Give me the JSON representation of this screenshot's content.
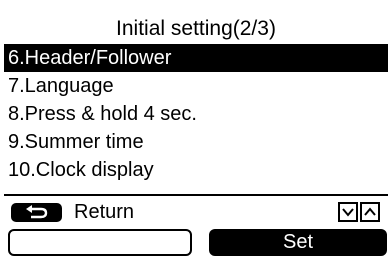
{
  "header": {
    "title": "Initial setting(2/3)"
  },
  "menu": {
    "items": [
      {
        "label": "6.Header/Follower",
        "selected": true
      },
      {
        "label": "7.Language",
        "selected": false
      },
      {
        "label": "8.Press & hold 4 sec.",
        "selected": false
      },
      {
        "label": "9.Summer time",
        "selected": false
      },
      {
        "label": "10.Clock display",
        "selected": false
      }
    ]
  },
  "footer": {
    "return_icon": "return-arrow-icon",
    "return_label": "Return",
    "nav_icons": [
      "down-arrow-icon",
      "up-arrow-icon"
    ],
    "left_softkey_label": "",
    "set_label": "Set"
  }
}
